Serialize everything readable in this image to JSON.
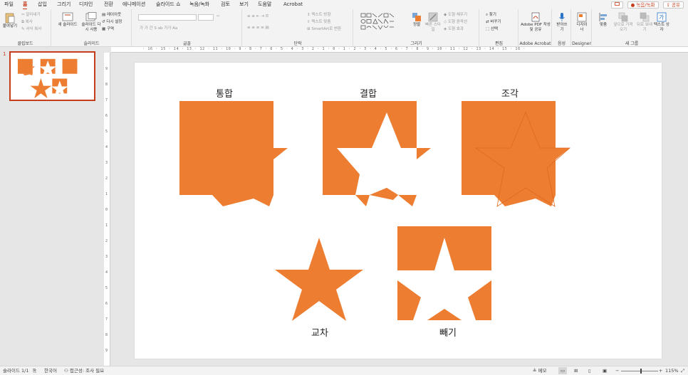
{
  "menu": {
    "tabs": [
      "파일",
      "홈",
      "삽입",
      "그리기",
      "디자인",
      "전환",
      "애니메이션",
      "슬라이드 쇼",
      "녹음/녹화",
      "검토",
      "보기",
      "도움말",
      "Acrobat"
    ],
    "active": "홈",
    "record_label": "녹음/녹화",
    "share_label": "공유"
  },
  "ribbon": {
    "clipboard": {
      "paste": "붙여넣기",
      "cut": "잘라내기",
      "copy": "복사",
      "format_painter": "서식 복사",
      "label": "클립보드"
    },
    "slides": {
      "new_slide": "새 슬라이드",
      "reuse_slides": "슬라이드 다시 사용",
      "layout": "레이아웃",
      "reset": "다시 설정",
      "section": "구역",
      "label": "슬라이드"
    },
    "font": {
      "label": "글꼴",
      "tools": "가 가 간 S ab 가가 Aa"
    },
    "paragraph": {
      "text_direction": "텍스트 방향",
      "align_text": "텍스트 맞춤",
      "smartart": "SmartArt로 변환",
      "label": "단락"
    },
    "drawing": {
      "arrange": "정렬",
      "quick_styles": "빠른 스타일",
      "fill": "도형 채우기",
      "outline": "도형 윤곽선",
      "effects": "도형 효과",
      "label": "그리기"
    },
    "editing": {
      "find": "찾기",
      "replace": "바꾸기",
      "select": "선택",
      "label": "편집"
    },
    "acrobat": {
      "create_pdf": "Adobe PDF 작성 및 공유",
      "label": "Adobe Acrobat"
    },
    "voice": {
      "dictate": "받아쓰기",
      "label": "음성"
    },
    "designer": {
      "designer": "디자이너",
      "label": "Designer"
    },
    "new_group": {
      "align": "맞춤",
      "bring_forward": "앞으로 가져오기",
      "send_backward": "뒤로 보내기",
      "textbox": "텍스트 상자",
      "label": "새 그룹"
    }
  },
  "rulers": {
    "h": "· 16 · 15 · 14 · 13 · 12 · 11 · 10 · 9 · 8 · 7 · 6 · 5 · 4 · 3 · 2 · 1 · 0 · 1 · 2 · 3 · 4 · 5 · 6 · 7 · 8 · 9 · 10 · 11 · 12 · 13 · 14 · 15 · 16 ·",
    "v": [
      "9",
      "8",
      "7",
      "6",
      "5",
      "4",
      "3",
      "2",
      "1",
      "0",
      "1",
      "2",
      "3",
      "4",
      "5",
      "6",
      "7",
      "8",
      "9"
    ]
  },
  "thumbnail": {
    "number": "1"
  },
  "slide": {
    "labels": {
      "union": "통합",
      "combine": "결합",
      "fragment": "조각",
      "intersect": "교차",
      "subtract": "빼기"
    },
    "shape_color": "#ed7d31"
  },
  "status": {
    "slide_count": "슬라이드 1/1",
    "language": "한국어",
    "accessibility": "접근성: 조사 필요",
    "notes": "메모",
    "zoom": "115%"
  }
}
